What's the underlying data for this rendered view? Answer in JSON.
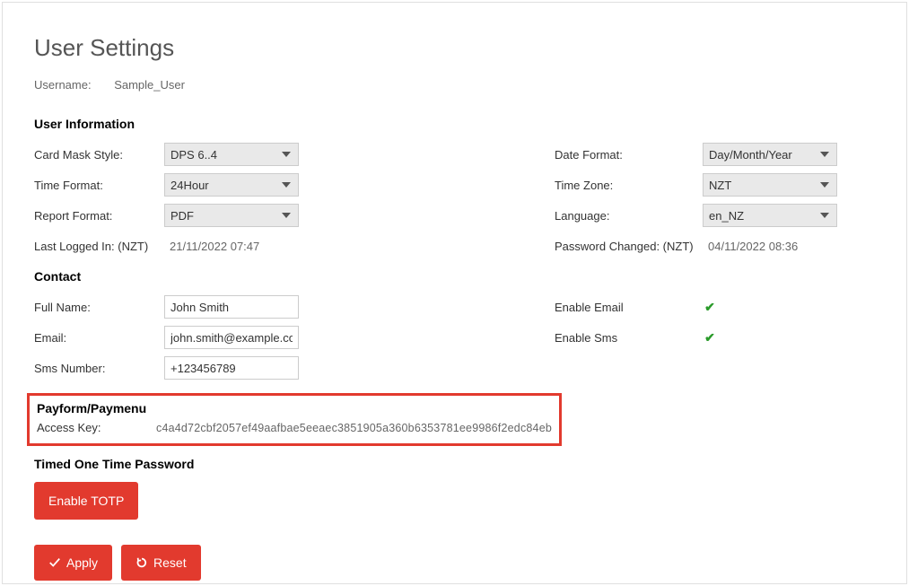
{
  "page": {
    "title": "User Settings"
  },
  "username": {
    "label": "Username:",
    "value": "Sample_User"
  },
  "sections": {
    "user_info": "User Information",
    "contact": "Contact",
    "payform": "Payform/Paymenu",
    "totp": "Timed One Time Password"
  },
  "user_info": {
    "card_mask_label": "Card Mask Style:",
    "card_mask_value": "DPS 6..4",
    "time_format_label": "Time Format:",
    "time_format_value": "24Hour",
    "report_format_label": "Report Format:",
    "report_format_value": "PDF",
    "last_logged_label": "Last Logged In: (NZT)",
    "last_logged_value": "21/11/2022 07:47",
    "date_format_label": "Date Format:",
    "date_format_value": "Day/Month/Year",
    "time_zone_label": "Time Zone:",
    "time_zone_value": "NZT",
    "language_label": "Language:",
    "language_value": "en_NZ",
    "pw_changed_label": "Password Changed: (NZT)",
    "pw_changed_value": "04/11/2022 08:36"
  },
  "contact": {
    "full_name_label": "Full Name:",
    "full_name_value": "John Smith",
    "email_label": "Email:",
    "email_value": "john.smith@example.com",
    "sms_label": "Sms Number:",
    "sms_value": "+123456789",
    "enable_email_label": "Enable Email",
    "enable_sms_label": "Enable Sms"
  },
  "payform": {
    "access_key_label": "Access Key:",
    "access_key_value": "c4a4d72cbf2057ef49aafbae5eeaec3851905a360b6353781ee9986f2edc84eb"
  },
  "buttons": {
    "enable_totp": "Enable TOTP",
    "apply": "Apply",
    "reset": "Reset"
  }
}
